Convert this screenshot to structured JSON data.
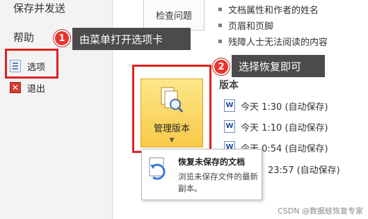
{
  "nav": {
    "save_send": "保存并发送",
    "help": "帮助",
    "options": "选项",
    "exit": "退出"
  },
  "main": {
    "inspect_button": "检查问题",
    "bullets": [
      "文档属性和作者的姓名",
      "页眉和页脚",
      "残障人士无法阅读的内容"
    ],
    "manage_versions_button": "管理版本",
    "versions_title": "版本",
    "versions": [
      "今天 1:30 (自动保存)",
      "今天 1:10 (自动保存)",
      "今天 0:54 (自动保存)",
      "23:57 (自动保存)"
    ]
  },
  "popup": {
    "title": "恢复未保存的文档",
    "description": "浏览未保存文件的最新副本。"
  },
  "callouts": {
    "step1_number": "1",
    "step1_text": "由菜单打开选项卡",
    "step2_number": "2",
    "step2_text": "选择恢复即可"
  },
  "watermark": "CSDN @数据蛙恢复专家",
  "colors": {
    "highlight_red": "#e02020",
    "badge_red": "#e8342c",
    "callout_bg": "#4b4b4b",
    "manage_button_yellow": "#f7c948"
  }
}
